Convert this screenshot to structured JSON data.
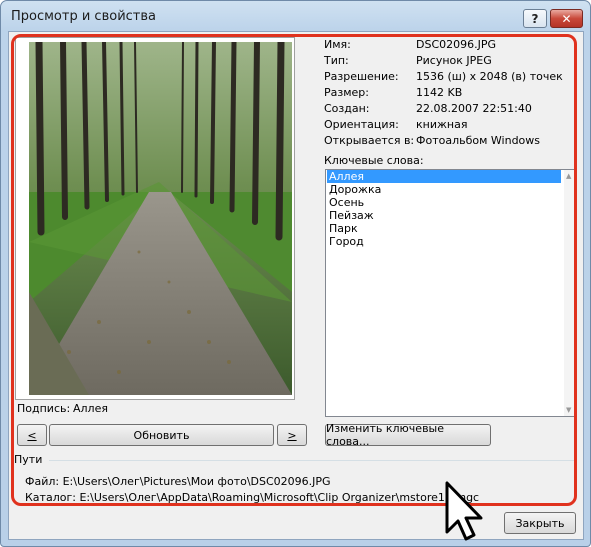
{
  "window": {
    "title": "Просмотр и свойства",
    "help_label": "?",
    "close_label": "✕"
  },
  "caption": {
    "label": "Подпись:",
    "value": "Аллея"
  },
  "nav": {
    "prev": "<",
    "refresh": "Обновить",
    "next": ">"
  },
  "properties": [
    {
      "label": "Имя:",
      "value": "DSC02096.JPG"
    },
    {
      "label": "Тип:",
      "value": "Рисунок JPEG"
    },
    {
      "label": "Разрешение:",
      "value": "1536 (ш) х 2048 (в) точек"
    },
    {
      "label": "Размер:",
      "value": "1142 KB"
    },
    {
      "label": "Создан:",
      "value": "22.08.2007 22:51:40"
    },
    {
      "label": "Ориентация:",
      "value": "книжная"
    },
    {
      "label": "Открывается в:",
      "value": "Фотоальбом Windows"
    }
  ],
  "keywords": {
    "label": "Ключевые слова:",
    "items": [
      "Аллея",
      "Дорожка",
      "Осень",
      "Пейзаж",
      "Парк",
      "Город"
    ],
    "selected": 0,
    "edit_button": "Изменить ключевые слова..."
  },
  "paths": {
    "heading": "Пути",
    "file_label": "Файл:",
    "file_value": "E:\\Users\\Олег\\Pictures\\Мои фото\\DSC02096.JPG",
    "folder_label": "Каталог:",
    "folder_value": "E:\\Users\\Олег\\AppData\\Roaming\\Microsoft\\Clip Organizer\\mstore10.mgc"
  },
  "close_button": "Закрыть",
  "colors": {
    "highlight": "#e0321e",
    "selection": "#3399ff"
  }
}
